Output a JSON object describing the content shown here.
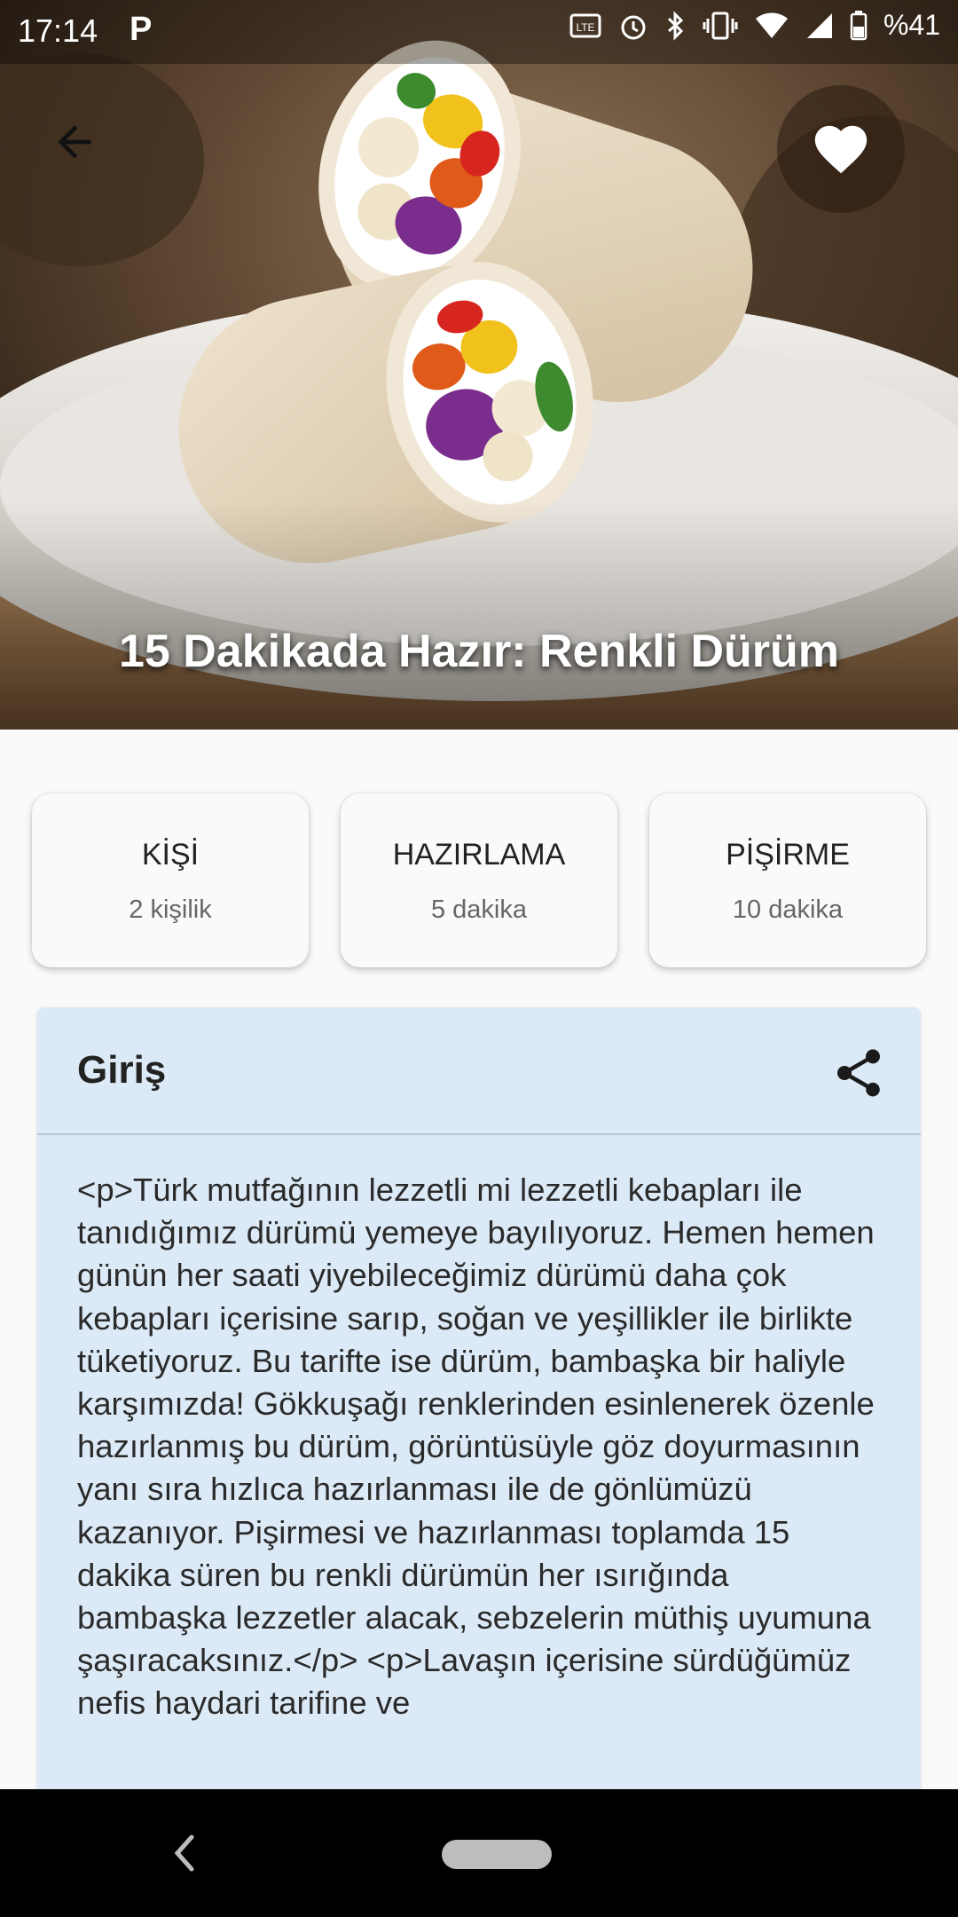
{
  "status_bar": {
    "time": "17:14",
    "app_letter": "P",
    "battery": "%41"
  },
  "recipe": {
    "title": "15 Dakikada Hazır: Renkli Dürüm"
  },
  "info_cards": [
    {
      "label": "KİŞİ",
      "value": "2 kişilik"
    },
    {
      "label": "HAZIRLAMA",
      "value": "5 dakika"
    },
    {
      "label": "PİŞİRME",
      "value": "10 dakika"
    }
  ],
  "intro": {
    "title": "Giriş",
    "text": "<p>Türk mutfağının lezzetli mi lezzetli kebapları ile tanıdığımız dürümü yemeye bayılıyoruz. Hemen hemen günün her saati yiyebileceğimiz dürümü daha çok kebapları içerisine sarıp, soğan ve yeşillikler ile birlikte tüketiyoruz. Bu tarifte ise dürüm, bambaşka bir haliyle karşımızda! Gökkuşağı renklerinden esinlenerek özenle hazırlanmış bu dürüm, görüntüsüyle göz doyurmasının yanı sıra hızlıca hazırlanması ile de gönlümüzü kazanıyor. Pişirmesi ve hazırlanması toplamda 15 dakika süren bu renkli dürümün her ısırığında bambaşka lezzetler alacak, sebzelerin müthiş uyumuna şaşıracaksınız.</p> <p>Lavaşın içerisine sürdüğümüz nefis haydari tarifine ve"
  },
  "icons": {
    "back": "arrow-left-icon",
    "favorite": "heart-icon",
    "share": "share-icon",
    "nav_back": "chevron-left-icon"
  },
  "colors": {
    "intro_background": "#dbeaf6",
    "card_background": "#fafafa",
    "favorite_circle": "#3a2a1c"
  }
}
